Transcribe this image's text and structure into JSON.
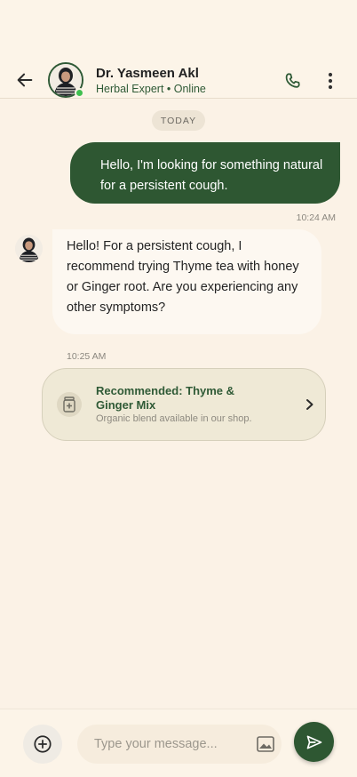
{
  "header": {
    "back_icon": "arrow-left-icon",
    "contact_name": "Dr. Yasmeen Akl",
    "contact_status": "Herbal Expert • Online",
    "call_icon": "phone-icon",
    "more_icon": "more-vertical-icon"
  },
  "chat": {
    "date_label": "TODAY",
    "outgoing": {
      "text": "Hello, I'm looking for something natural for a persistent cough.",
      "time": "10:24 AM"
    },
    "incoming": {
      "text": "Hello! For a persistent cough, I recommend trying Thyme tea with honey or Ginger root. Are you experiencing any other symptoms?",
      "time": "10:25 AM"
    },
    "recommendation": {
      "icon": "medicine-jar-icon",
      "title": "Recommended: Thyme & Ginger Mix",
      "subtitle": "Organic blend available in our shop."
    }
  },
  "composer": {
    "attach_icon": "plus-circle-icon",
    "placeholder": "Type your message...",
    "image_icon": "image-icon",
    "send_icon": "send-icon"
  },
  "colors": {
    "background": "#fbf2e6",
    "brand_green": "#2e5732",
    "online": "#3fbf4f"
  }
}
